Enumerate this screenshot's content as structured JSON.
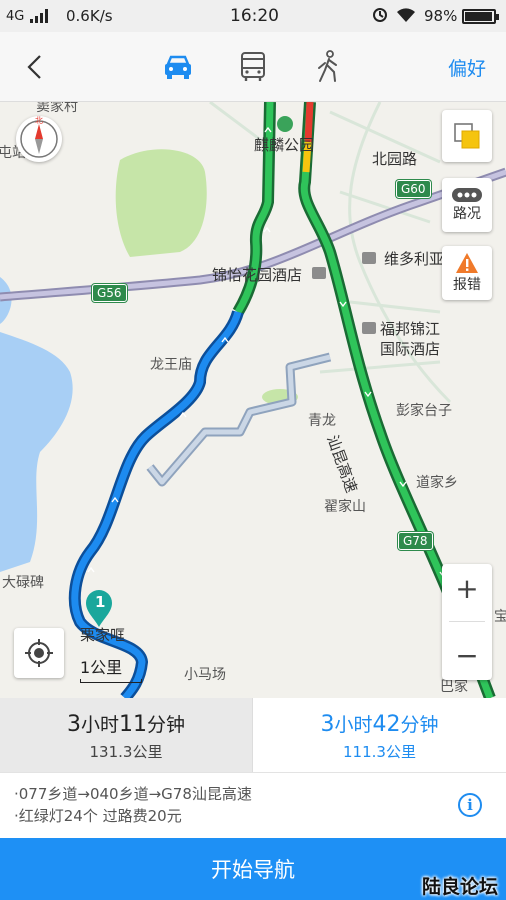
{
  "status_bar": {
    "network": "4G",
    "speed": "0.6K/s",
    "time": "16:20",
    "battery": "98%",
    "battery_level": 0.98
  },
  "nav": {
    "tabs": [
      {
        "name": "car-icon",
        "active": true
      },
      {
        "name": "bus-icon",
        "active": false
      },
      {
        "name": "walk-icon",
        "active": false
      }
    ],
    "preference_label": "偏好"
  },
  "map": {
    "labels": {
      "village_top": "窦家村",
      "station": "屯站",
      "park": "麒麟公园",
      "beiyuan_road": "北园路",
      "jinyi_hotel": "锦怡花园酒店",
      "weiduoli": "维多利亚",
      "fubang_hotel_line1": "福邦锦江",
      "fubang_hotel_line2": "国际酒店",
      "longwangmiao": "龙王庙",
      "qinglong": "青龙",
      "pengjiataizi": "彭家台子",
      "expressway": "汕昆高速",
      "daojiaxiang": "道家乡",
      "zhaijiashan": "翟家山",
      "daluobei": "大碌碑",
      "lijiaqu": "栗家哐",
      "xiaomachang": "小马场",
      "bajia": "巴家",
      "bao": "宝"
    },
    "shields": {
      "g60": "G60",
      "g56": "G56",
      "g78": "G78"
    },
    "controls": {
      "layers_icon": "layers-icon",
      "traffic_label": "路况",
      "report_label": "报错",
      "zoom_in": "+",
      "zoom_out": "−"
    },
    "compass_label": "北",
    "pin_label": "1",
    "scale": "1公里"
  },
  "routes": [
    {
      "hours": "3",
      "hours_unit": "小时",
      "minutes": "11",
      "minutes_unit": "分钟",
      "distance": "131.3公里",
      "selected": false
    },
    {
      "hours": "3",
      "hours_unit": "小时",
      "minutes": "42",
      "minutes_unit": "分钟",
      "distance": "111.3公里",
      "selected": true
    }
  ],
  "route_detail": {
    "path": "·077乡道→040乡道→G78汕昆高速",
    "extra": "·红绿灯24个  过路费20元"
  },
  "start_button": "开始导航",
  "watermark": "陆良论坛",
  "colors": {
    "accent": "#1e8cf0",
    "route_green": "#1fb454",
    "route_blue": "#1d8bf0"
  }
}
